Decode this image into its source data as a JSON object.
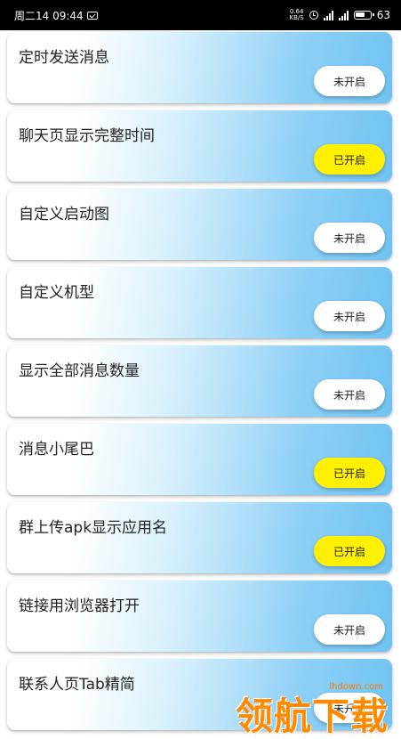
{
  "status_bar": {
    "day_time": "周二14 09:44",
    "net_speed_value": "0.64",
    "net_speed_unit": "KB/S",
    "battery": "63",
    "signal_label_1": "4G",
    "signal_label_2": "4G"
  },
  "items": [
    {
      "title": "定时发送消息",
      "toggle": "未开启",
      "state": "off"
    },
    {
      "title": "聊天页显示完整时间",
      "toggle": "已开启",
      "state": "on"
    },
    {
      "title": "自定义启动图",
      "toggle": "未开启",
      "state": "off"
    },
    {
      "title": "自定义机型",
      "toggle": "未开启",
      "state": "off"
    },
    {
      "title": "显示全部消息数量",
      "toggle": "未开启",
      "state": "off"
    },
    {
      "title": "消息小尾巴",
      "toggle": "已开启",
      "state": "on"
    },
    {
      "title": "群上传apk显示应用名",
      "toggle": "已开启",
      "state": "on"
    },
    {
      "title": "链接用浏览器打开",
      "toggle": "未开启",
      "state": "off"
    },
    {
      "title": "联系人页Tab精简",
      "toggle": "未开启",
      "state": "off"
    }
  ],
  "watermark": {
    "url": "lhdown.com",
    "text": "领航下载"
  },
  "colors": {
    "toggle_on": "#ffef00",
    "toggle_off": "#ffffff",
    "card_gradient_end": "#6fc3f2"
  }
}
